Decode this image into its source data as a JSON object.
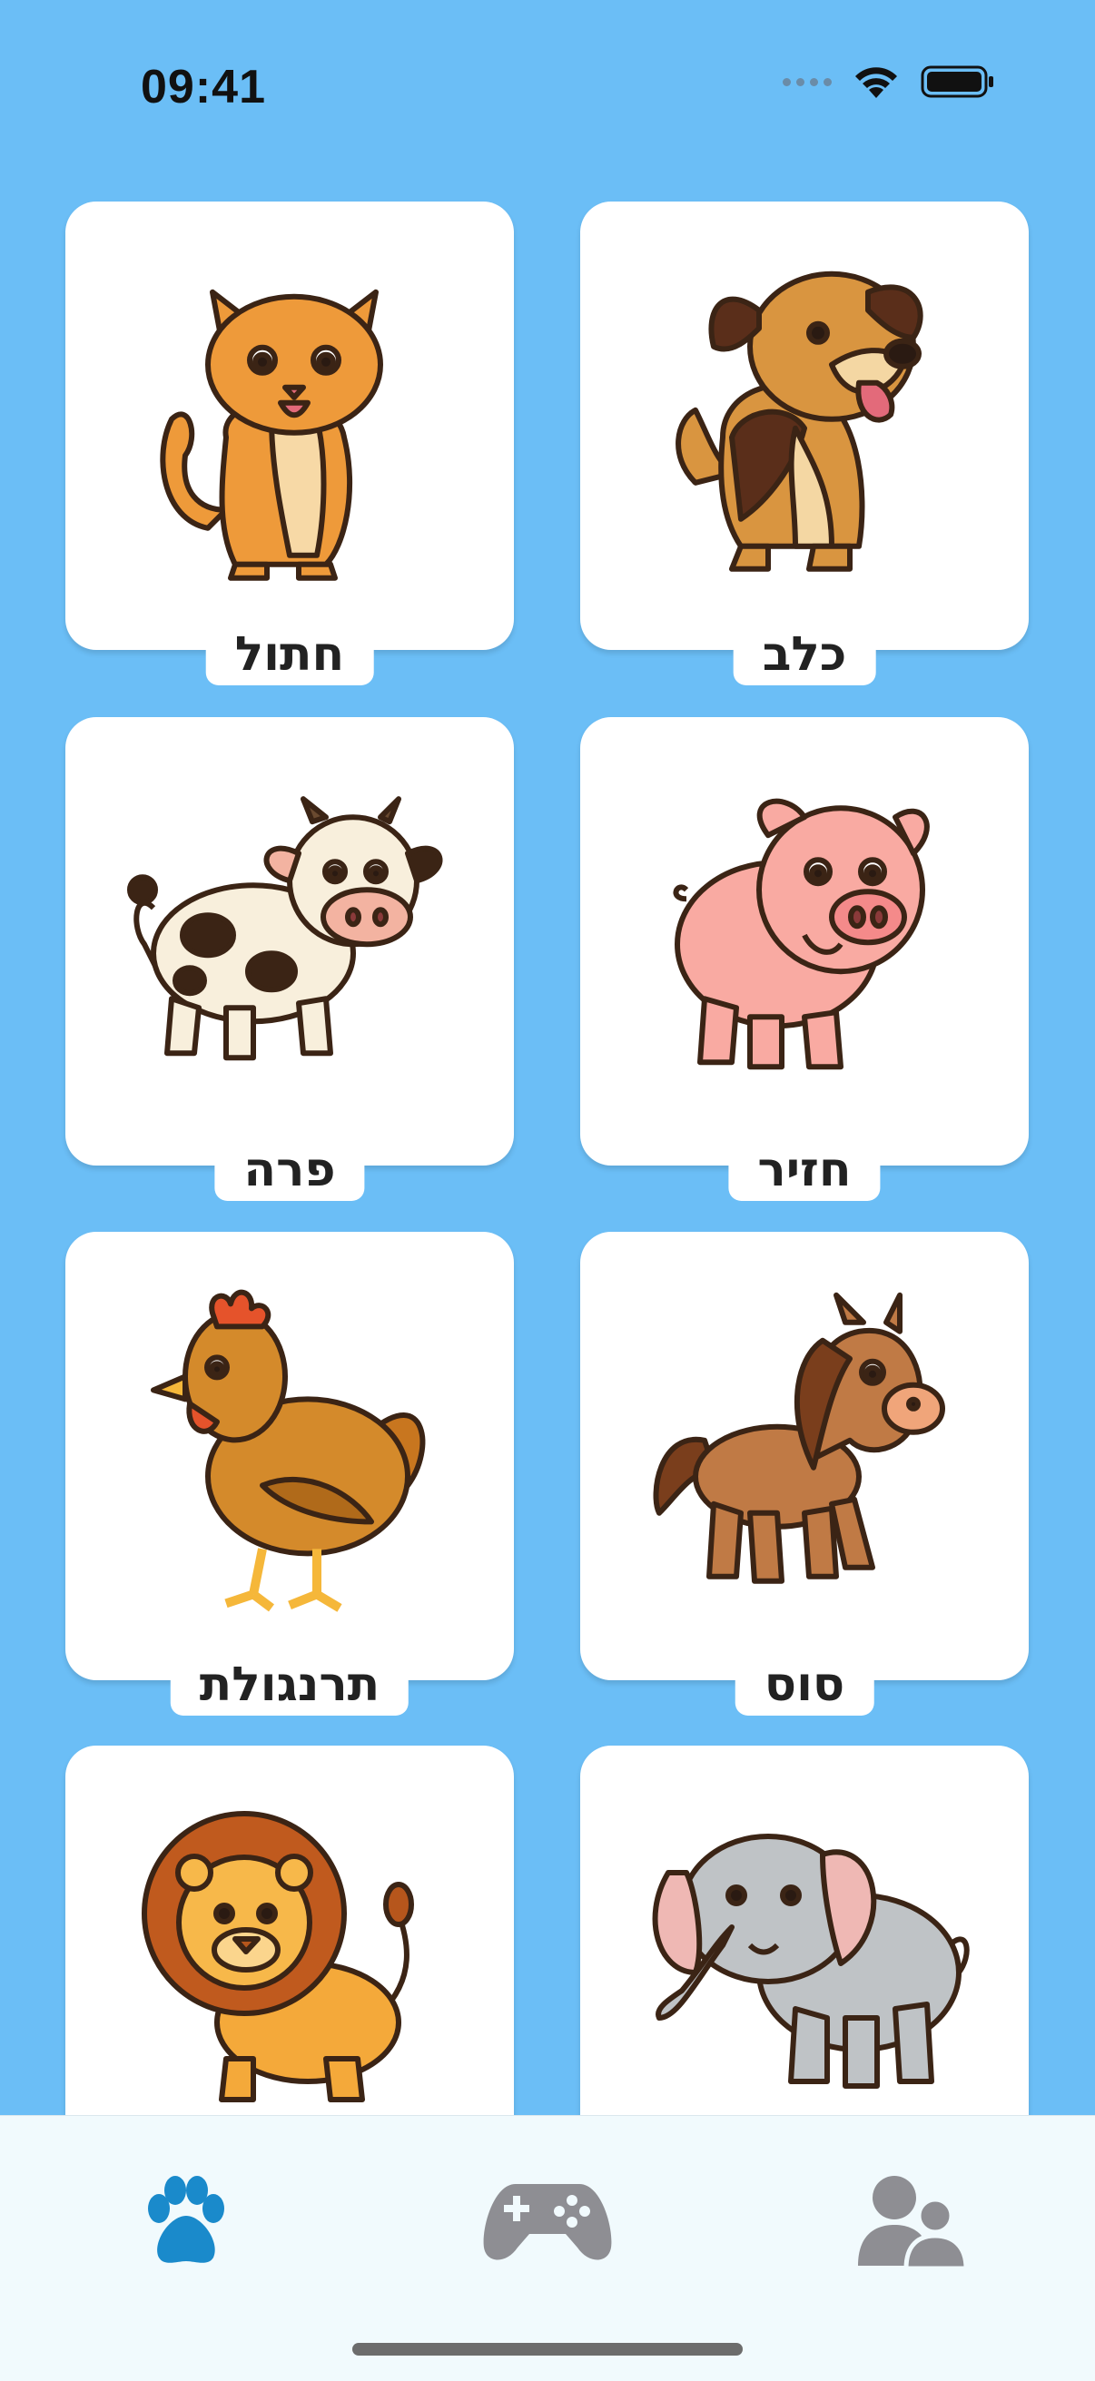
{
  "status": {
    "time": "09:41"
  },
  "animals": [
    {
      "label": "כלב",
      "icon": "dog-icon"
    },
    {
      "label": "חתול",
      "icon": "cat-icon"
    },
    {
      "label": "חזיר",
      "icon": "pig-icon"
    },
    {
      "label": "פרה",
      "icon": "cow-icon"
    },
    {
      "label": "סוס",
      "icon": "horse-icon"
    },
    {
      "label": "תרנגולת",
      "icon": "chicken-icon"
    },
    {
      "label": "",
      "icon": "elephant-icon"
    },
    {
      "label": "",
      "icon": "lion-icon"
    }
  ],
  "tabs": [
    {
      "icon": "paw-icon",
      "active": true
    },
    {
      "icon": "gamepad-icon",
      "active": false
    },
    {
      "icon": "profile-icon",
      "active": false
    }
  ],
  "colors": {
    "background": "#6BBEF6",
    "active_tab": "#1A8ACB",
    "inactive_tab": "#8E8E93"
  }
}
